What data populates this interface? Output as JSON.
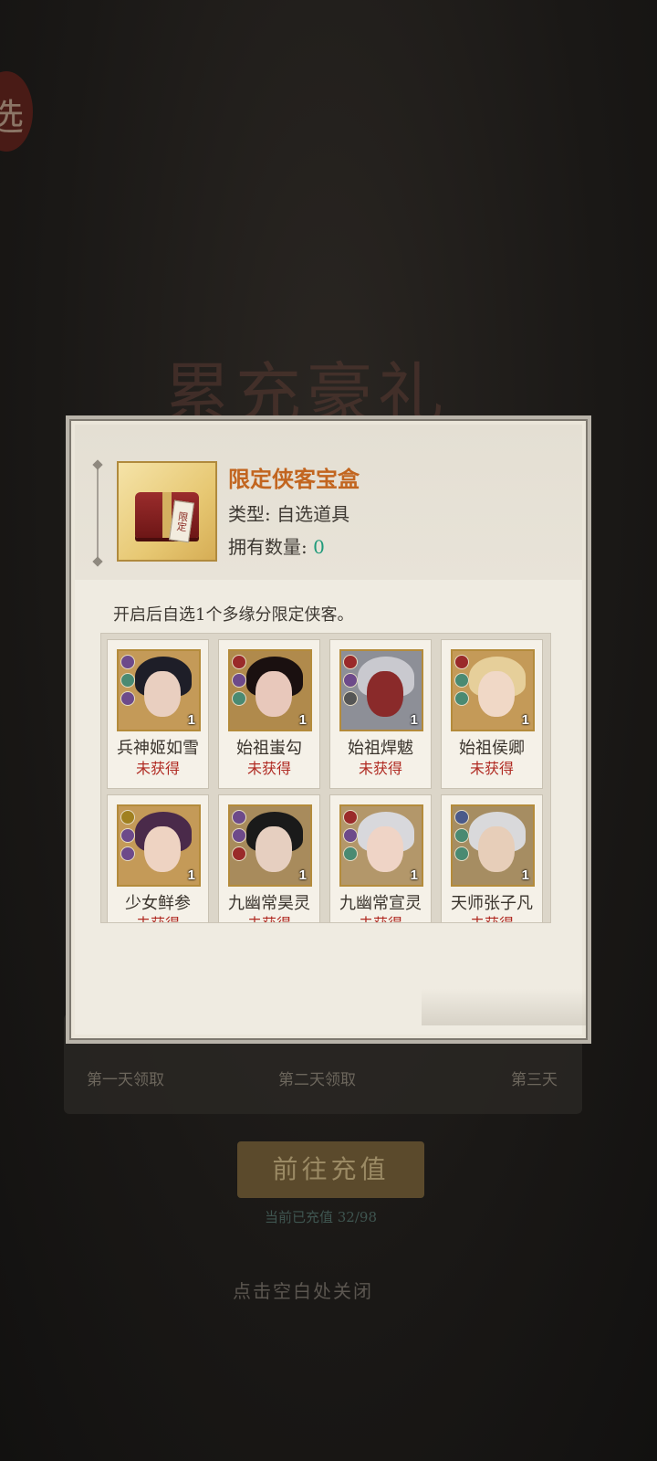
{
  "background": {
    "seal_text": "选",
    "banner_title": "累充豪礼",
    "day_labels": [
      "第一天领取",
      "第二天领取",
      "第三天"
    ],
    "recharge_button": "前往充值",
    "recharge_note": "当前已充值 32/98",
    "close_hint": "点击空白处关闭"
  },
  "item": {
    "name": "限定侠客宝盒",
    "type_label": "类型: 自选道具",
    "owned_prefix": "拥有数量: ",
    "owned_count": "0",
    "tag_text": "限定",
    "description": "开启后自选1个多缘分限定侠客。"
  },
  "heroes": [
    {
      "name": "兵神姬如雪",
      "status": "未获得",
      "count": "1",
      "hair": "#1e1e28",
      "skin": "#e9cfc0",
      "bg": "#c49a58",
      "badges": [
        "#6d4a8a",
        "#4a8a72",
        "#6d4a8a"
      ]
    },
    {
      "name": "始祖蚩勾",
      "status": "未获得",
      "count": "1",
      "hair": "#1a1010",
      "skin": "#e8c8bb",
      "bg": "#b08a4c",
      "badges": [
        "#9a2a2a",
        "#6d4a8a",
        "#4a8a72"
      ]
    },
    {
      "name": "始祖焊魃",
      "status": "未获得",
      "count": "1",
      "hair": "#c9c9cf",
      "skin": "#8a2a2a",
      "bg": "#8d8f97",
      "badges": [
        "#9a2a2a",
        "#6d4a8a",
        "#555555"
      ]
    },
    {
      "name": "始祖侯卿",
      "status": "未获得",
      "count": "1",
      "hair": "#e6cf9a",
      "skin": "#f0d8c6",
      "bg": "#c49a58",
      "badges": [
        "#9a2a2a",
        "#4a8a72",
        "#4a8a72"
      ]
    },
    {
      "name": "少女鲜参",
      "status": "未获得",
      "count": "1",
      "hair": "#4a2a4a",
      "skin": "#eed3c2",
      "bg": "#c49a58",
      "badges": [
        "#a08020",
        "#6d4a8a",
        "#6d4a8a"
      ]
    },
    {
      "name": "九幽常昊灵",
      "status": "未获得",
      "count": "1",
      "hair": "#1a1a1a",
      "skin": "#e6cfc0",
      "bg": "#a88b5c",
      "badges": [
        "#6d4a8a",
        "#6d4a8a",
        "#9a2a2a"
      ]
    },
    {
      "name": "九幽常宣灵",
      "status": "未获得",
      "count": "1",
      "hair": "#d8d8dc",
      "skin": "#efd4c6",
      "bg": "#b3976a",
      "badges": [
        "#9a2a2a",
        "#6d4a8a",
        "#4a8a72"
      ]
    },
    {
      "name": "天师张子凡",
      "status": "未获得",
      "count": "1",
      "hair": "#d9d9db",
      "skin": "#e7ceb9",
      "bg": "#a68d62",
      "badges": [
        "#4a5a8a",
        "#4a8a72",
        "#4a8a72"
      ]
    }
  ]
}
